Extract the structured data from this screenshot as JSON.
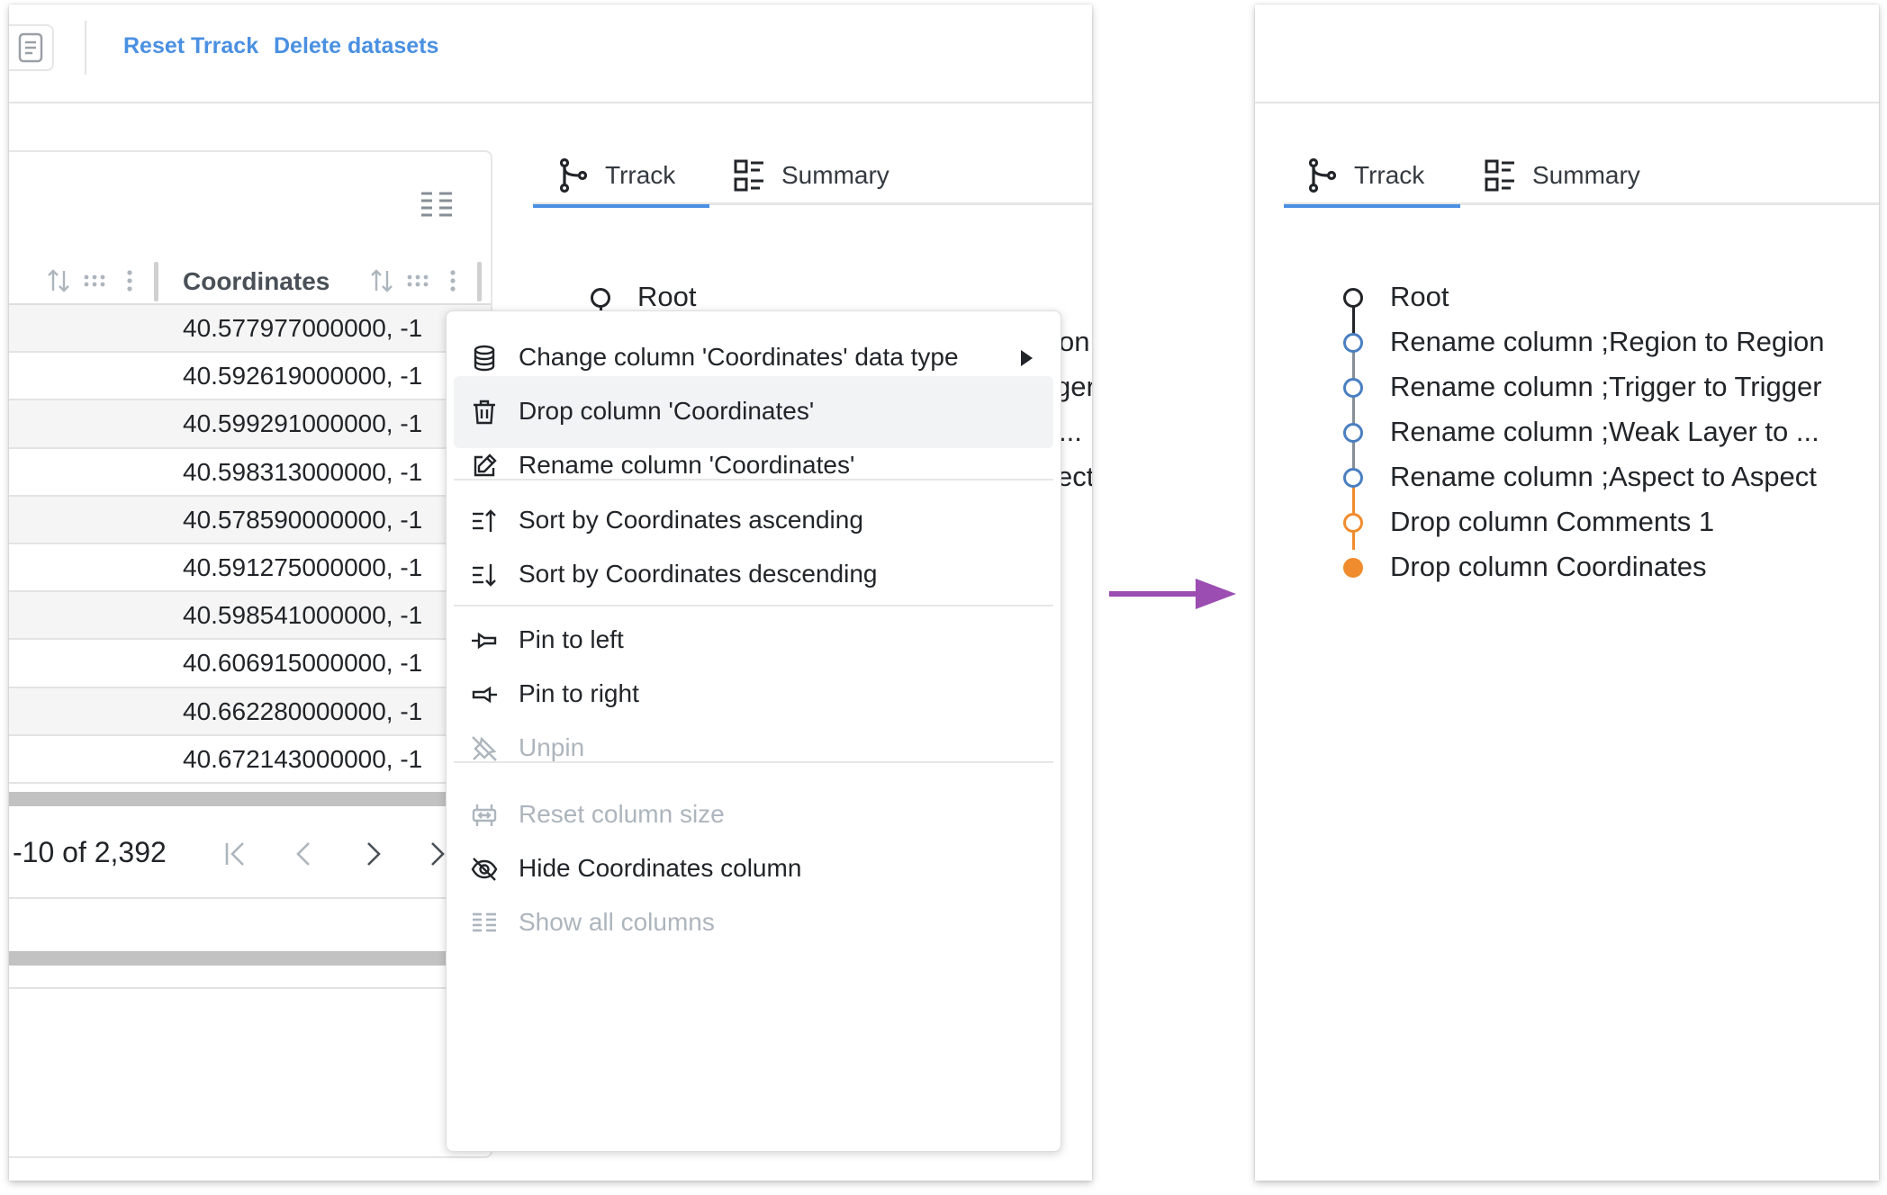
{
  "left_panel": {
    "header": {
      "reset_label": "Reset Trrack",
      "delete_label": "Delete datasets"
    },
    "table": {
      "column_title": "Coordinates",
      "rows": [
        "40.577977000000, -1",
        "40.592619000000, -1",
        "40.599291000000, -1",
        "40.598313000000, -1",
        "40.578590000000, -1",
        "40.591275000000, -1",
        "40.598541000000, -1",
        "40.606915000000, -1",
        "40.662280000000, -1",
        "40.672143000000, -1"
      ],
      "pagination_text": "-10 of 2,392"
    },
    "tabs": {
      "track": "Trrack",
      "summary": "Summary"
    },
    "tree": {
      "root": "Root",
      "partial_labels": [
        "on",
        "ger",
        "...",
        "ect"
      ]
    },
    "context_menu": {
      "items": [
        {
          "label": "Change column 'Coordinates' data type",
          "icon": "database-icon"
        },
        {
          "label": "Drop column 'Coordinates'",
          "icon": "trash-icon"
        },
        {
          "label": "Rename column 'Coordinates'",
          "icon": "edit-icon"
        },
        {
          "label": "Sort by Coordinates ascending",
          "icon": "sort-ascending-icon"
        },
        {
          "label": "Sort by Coordinates descending",
          "icon": "sort-descending-icon"
        },
        {
          "label": "Pin to left",
          "icon": "pin-left-icon"
        },
        {
          "label": "Pin to right",
          "icon": "pin-right-icon"
        },
        {
          "label": "Unpin",
          "icon": "unpin-icon"
        },
        {
          "label": "Reset column size",
          "icon": "reset-size-icon"
        },
        {
          "label": "Hide Coordinates column",
          "icon": "eye-off-icon"
        },
        {
          "label": "Show all columns",
          "icon": "columns-icon"
        }
      ]
    }
  },
  "right_panel": {
    "tabs": {
      "track": "Trrack",
      "summary": "Summary"
    },
    "tree": {
      "nodes": [
        {
          "label": "Root",
          "status": "root"
        },
        {
          "label": "Rename column ;Region to Region",
          "status": "blue"
        },
        {
          "label": "Rename column ;Trigger to Trigger",
          "status": "blue"
        },
        {
          "label": "Rename column ;Weak Layer to ...",
          "status": "blue"
        },
        {
          "label": "Rename column ;Aspect to Aspect",
          "status": "blue"
        },
        {
          "label": "Drop column Comments 1",
          "status": "orange"
        },
        {
          "label": "Drop column Coordinates",
          "status": "orange-current"
        }
      ]
    }
  },
  "colors": {
    "accent_blue": "#4a90e2",
    "node_blue": "#4a7fc1",
    "node_orange": "#f08c2e",
    "arrow_purple": "#9b4db1",
    "disabled_gray": "#adb5bd"
  }
}
